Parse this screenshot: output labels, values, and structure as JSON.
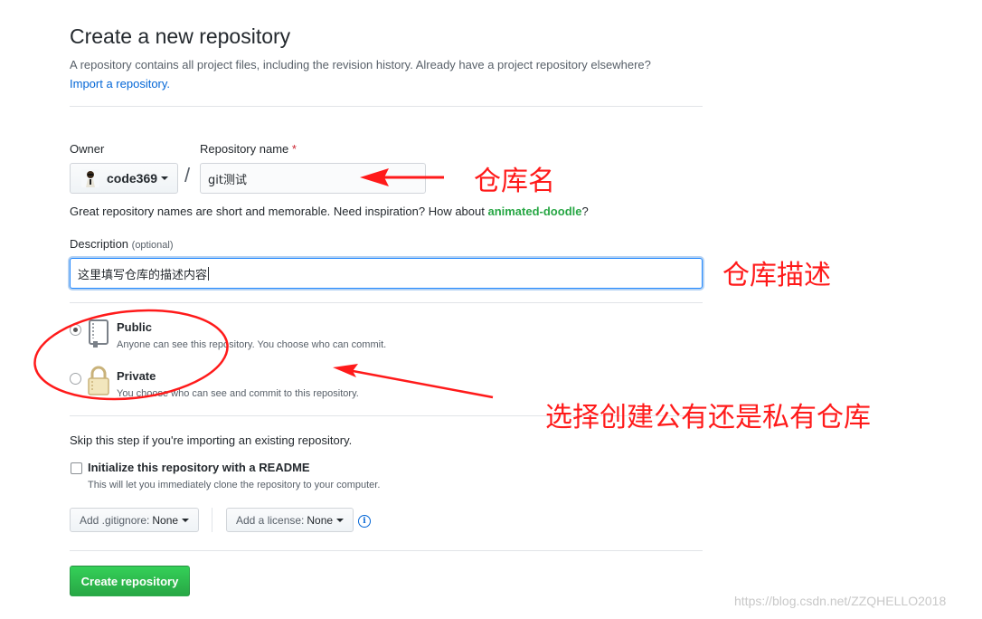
{
  "header": {
    "title": "Create a new repository",
    "subtitle": "A repository contains all project files, including the revision history. Already have a project repository elsewhere?",
    "import_link": "Import a repository."
  },
  "owner": {
    "label": "Owner",
    "value": "code369"
  },
  "repo_name": {
    "label": "Repository name",
    "required_mark": "*",
    "value": "git测试"
  },
  "name_hint": {
    "prefix": "Great repository names are short and memorable. Need inspiration? How about ",
    "suggestion": "animated-doodle",
    "suffix": "?"
  },
  "description": {
    "label": "Description",
    "optional": "(optional)",
    "value": "这里填写仓库的描述内容"
  },
  "visibility": {
    "public_title": "Public",
    "public_desc": "Anyone can see this repository. You choose who can commit.",
    "private_title": "Private",
    "private_desc": "You choose who can see and commit to this repository.",
    "selected": "public"
  },
  "init": {
    "skip_text": "Skip this step if you're importing an existing repository.",
    "readme_title": "Initialize this repository with a README",
    "readme_desc": "This will let you immediately clone the repository to your computer.",
    "gitignore_label": "Add .gitignore:",
    "gitignore_value": "None",
    "license_label": "Add a license:",
    "license_value": "None",
    "info_glyph": "i"
  },
  "submit": {
    "label": "Create repository"
  },
  "annotations": {
    "repo_name": "仓库名",
    "description": "仓库描述",
    "visibility": "选择创建公有还是私有仓库",
    "color": "#ff1a1a"
  },
  "watermark": "https://blog.csdn.net/ZZQHELLO2018",
  "colors": {
    "link": "#0366d6",
    "primary_green": "#28a745",
    "required": "#cb2431"
  }
}
